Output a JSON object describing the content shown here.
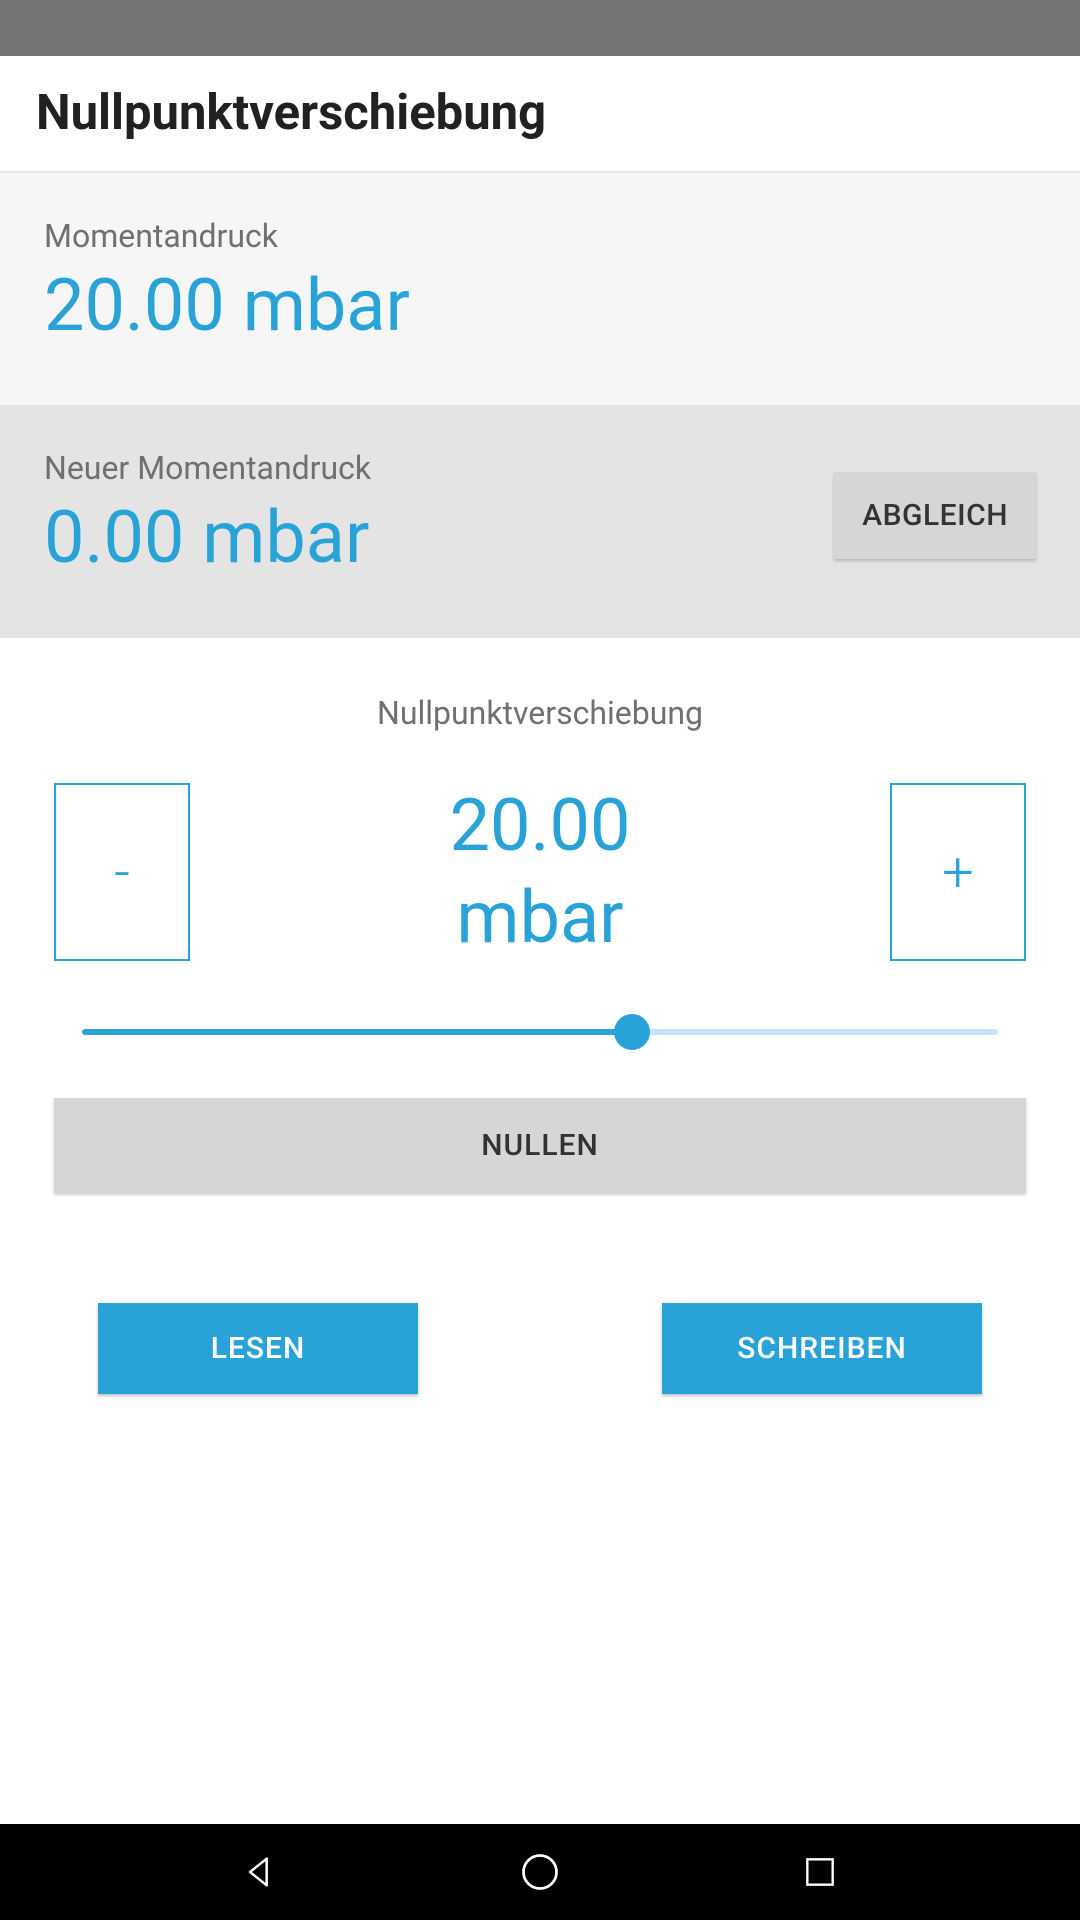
{
  "colors": {
    "accent": "#29a3d7",
    "statusBar": "#757575",
    "bgLight": "#f6f6f6",
    "bgMed": "#e4e4e4",
    "btnGray": "#d6d6d6"
  },
  "header": {
    "title": "Nullpunktverschiebung"
  },
  "current": {
    "label": "Momentandruck",
    "value": "20.00 mbar"
  },
  "newPressure": {
    "label": "Neuer Momentandruck",
    "value": "0.00 mbar",
    "abgleich_label": "ABGLEICH"
  },
  "offset": {
    "title": "Nullpunktverschiebung",
    "minus_label": "-",
    "plus_label": "+",
    "value_line1": "20.00",
    "value_line2": "mbar",
    "slider_percent": 60,
    "nullen_label": "NULLEN"
  },
  "actions": {
    "read_label": "LESEN",
    "write_label": "SCHREIBEN"
  },
  "nav": {
    "back": "back",
    "home": "home",
    "recent": "recent"
  }
}
